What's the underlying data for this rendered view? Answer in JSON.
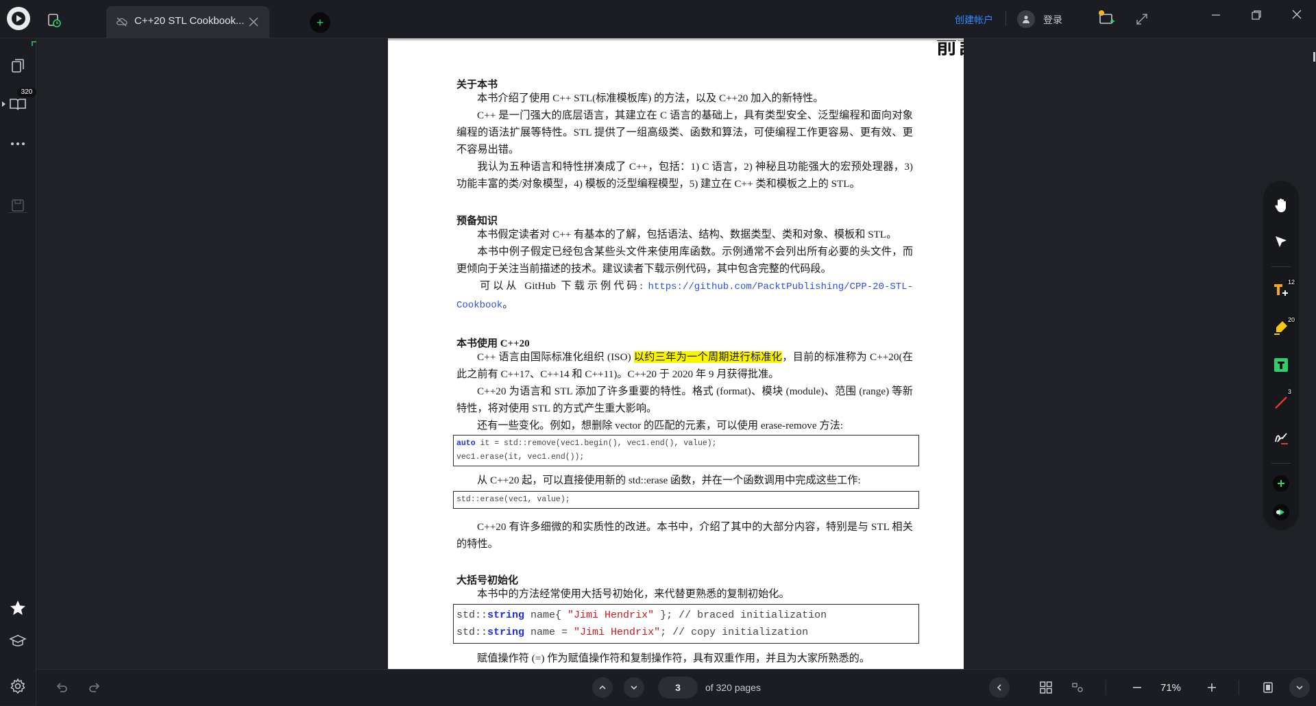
{
  "titlebar": {
    "tab_title": "C++20 STL Cookbook...",
    "create_account": "创建帐户",
    "login": "登录"
  },
  "sidebar": {
    "page_count_badge": "320",
    "icons": [
      "pages-icon",
      "book-icon",
      "more-icon",
      "save-icon",
      "star-icon",
      "learn-icon",
      "settings-icon"
    ]
  },
  "document": {
    "page_heading": "前言",
    "s1": {
      "title": "关于本书",
      "p1": "本书介绍了使用 C++ STL(标准模板库) 的方法，以及 C++20 加入的新特性。",
      "p2": "C++ 是一门强大的底层语言，其建立在 C 语言的基础上，具有类型安全、泛型编程和面向对象编程的语法扩展等特性。STL 提供了一组高级类、函数和算法，可使编程工作更容易、更有效、更不容易出错。",
      "p3": "我认为五种语言和特性拼凑成了 C++，包括：1) C 语言，2) 神秘且功能强大的宏预处理器，3) 功能丰富的类/对象模型，4) 模板的泛型编程模型，5) 建立在 C++ 类和模板之上的 STL。"
    },
    "s2": {
      "title": "预备知识",
      "p1": "本书假定读者对 C++ 有基本的了解，包括语法、结构、数据类型、类和对象、模板和 STL。",
      "p2": "本书中例子假定已经包含某些头文件来使用库函数。示例通常不会列出所有必要的头文件，而更倾向于关注当前描述的技术。建议读者下载示例代码，其中包含完整的代码段。",
      "p3_prefix": "可以从 GitHub 下载示例代码: ",
      "p3_link": "https://github.com/PacktPublishing/CPP-20-STL-Cookbook",
      "p3_suffix": "。"
    },
    "s3": {
      "title": "本书使用 C++20",
      "p1_prefix": "C++ 语言由国际标准化组织 (ISO) ",
      "p1_highlight": "以约三年为一个周期进行标准化",
      "p1_suffix": "，目前的标准称为 C++20(在此之前有 C++17、C++14 和 C++11)。C++20 于 2020 年 9 月获得批准。",
      "p2": "C++20 为语言和 STL 添加了许多重要的特性。格式 (format)、模块 (module)、范围 (range) 等新特性，将对使用 STL 的方式产生重大影响。",
      "p3": "还有一些变化。例如，想删除 vector 的匹配的元素，可以使用 erase-remove 方法:",
      "code1_kw": "auto",
      "code1_line1_rest": " it = std::remove(vec1.begin(), vec1.end(), value);",
      "code1_line2": "vec1.erase(it, vec1.end());",
      "p4": "从 C++20 起，可以直接使用新的 std::erase 函数，并在一个函数调用中完成这些工作:",
      "code2_line1": "std::erase(vec1, value);",
      "p5": "C++20 有许多细微的和实质性的改进。本书中，介绍了其中的大部分内容，特别是与 STL 相关的特性。"
    },
    "s4": {
      "title": "大括号初始化",
      "p1": "本书中的方法经常使用大括号初始化，来代替更熟悉的复制初始化。",
      "code_ns": "std::",
      "code_type": "string",
      "code_l1_mid": " name{ ",
      "code_l1_str": "\"Jimi Hendrix\"",
      "code_l1_end": " }; // braced initialization",
      "code_l2_mid": " name = ",
      "code_l2_str": "\"Jimi Hendrix\"",
      "code_l2_end": "; // copy initialization",
      "p2": "赋值操作符 (=) 作为赋值操作符和复制操作符，具有双重作用，并且为大家所熟悉的。"
    }
  },
  "tools": {
    "text_add_badge": "12",
    "highlight_badge": "20",
    "line_badge": "3"
  },
  "bottombar": {
    "current_page": "3",
    "of_pages": "of 320 pages",
    "zoom": "71%"
  },
  "colors": {
    "accent_green": "#2fd06b",
    "link_blue": "#2e8bff",
    "highlight_yellow": "#fbf400"
  }
}
